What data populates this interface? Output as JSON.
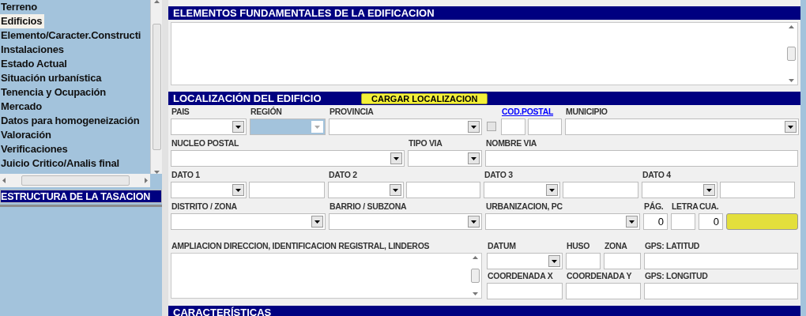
{
  "sidebar": {
    "items": [
      {
        "label": "Terreno",
        "selected": false
      },
      {
        "label": "Edificios",
        "selected": true
      },
      {
        "label": "Elemento/Caracter.Constructi",
        "selected": false
      },
      {
        "label": "Instalaciones",
        "selected": false
      },
      {
        "label": "Estado Actual",
        "selected": false
      },
      {
        "label": "Situación urbanística",
        "selected": false
      },
      {
        "label": "Tenencia y Ocupación",
        "selected": false
      },
      {
        "label": "Mercado",
        "selected": false
      },
      {
        "label": "Datos para homogeneización",
        "selected": false
      },
      {
        "label": "Valoración",
        "selected": false
      },
      {
        "label": "Verificaciones",
        "selected": false
      },
      {
        "label": "Juicio Critico/Analis final",
        "selected": false
      }
    ],
    "title": "ESTRUCTURA DE LA TASACION"
  },
  "memo_section": {
    "title": "ELEMENTOS FUNDAMENTALES DE LA EDIFICACION"
  },
  "location": {
    "title": "LOCALIZACIÓN DEL EDIFICIO",
    "action": "CARGAR LOCALIZACION",
    "rows": [
      {
        "fields": [
          {
            "label": "PAIS",
            "controls": [
              {
                "kind": "combo",
                "disabled": false
              }
            ]
          },
          {
            "label": "REGIÓN",
            "controls": [
              {
                "kind": "combo",
                "disabled": true
              }
            ]
          },
          {
            "label": "PROVINCIA",
            "controls": [
              {
                "kind": "combo",
                "disabled": false
              }
            ]
          },
          {
            "controls": [
              {
                "kind": "checkbox",
                "checked": false
              }
            ]
          },
          {
            "label": "COD.POSTAL",
            "link": true,
            "controls": [
              {
                "kind": "text"
              },
              {
                "kind": "text"
              }
            ]
          },
          {
            "label": "MUNICIPIO",
            "controls": [
              {
                "kind": "combo",
                "disabled": false
              }
            ]
          }
        ]
      },
      {
        "fields": [
          {
            "label": "NUCLEO POSTAL",
            "controls": [
              {
                "kind": "combo",
                "disabled": false
              }
            ]
          },
          {
            "label": "TIPO VIA",
            "controls": [
              {
                "kind": "combo",
                "disabled": false
              }
            ]
          },
          {
            "label": "NOMBRE VIA",
            "controls": [
              {
                "kind": "text"
              }
            ]
          }
        ]
      },
      {
        "fields": [
          {
            "label": "DATO 1",
            "controls": [
              {
                "kind": "combo",
                "disabled": false
              },
              {
                "kind": "text"
              }
            ]
          },
          {
            "label": "DATO 2",
            "controls": [
              {
                "kind": "combo",
                "disabled": false
              },
              {
                "kind": "text"
              }
            ]
          },
          {
            "label": "DATO 3",
            "controls": [
              {
                "kind": "combo",
                "disabled": false
              },
              {
                "kind": "text"
              }
            ]
          },
          {
            "label": "DATO 4",
            "controls": [
              {
                "kind": "combo",
                "disabled": false
              },
              {
                "kind": "text"
              }
            ]
          }
        ]
      },
      {
        "fields": [
          {
            "label": "DISTRITO / ZONA",
            "controls": [
              {
                "kind": "combo",
                "disabled": false
              }
            ]
          },
          {
            "label": "BARRIO / SUBZONA",
            "controls": [
              {
                "kind": "combo",
                "disabled": false
              }
            ]
          },
          {
            "label": "URBANIZACION, PC",
            "controls": [
              {
                "kind": "combo",
                "disabled": false
              }
            ]
          },
          {
            "label": "PÁG.",
            "controls": [
              {
                "kind": "text",
                "value": "0"
              }
            ]
          },
          {
            "label": "LETRA",
            "controls": [
              {
                "kind": "text"
              }
            ]
          },
          {
            "label": "CUA.",
            "controls": [
              {
                "kind": "text",
                "value": "0"
              }
            ]
          },
          {
            "controls": [
              {
                "kind": "button"
              }
            ]
          }
        ]
      }
    ],
    "notes": {
      "label": "AMPLIACION DIRECCION, IDENTIFICACION REGISTRAL, LINDEROS"
    },
    "coordinates": [
      {
        "fields": [
          {
            "label": "DATUM",
            "controls": [
              {
                "kind": "combo",
                "disabled": false
              }
            ]
          },
          {
            "label": "HUSO",
            "controls": [
              {
                "kind": "text"
              }
            ]
          },
          {
            "label": "ZONA",
            "controls": [
              {
                "kind": "text"
              }
            ]
          },
          {
            "label": "GPS: LATITUD",
            "controls": [
              {
                "kind": "text"
              }
            ]
          }
        ]
      },
      {
        "fields": [
          {
            "label": "COORDENADA X",
            "controls": [
              {
                "kind": "text"
              }
            ]
          },
          {
            "label": "COORDENADA Y",
            "controls": [
              {
                "kind": "text"
              }
            ]
          },
          {
            "label": "GPS: LONGITUD",
            "controls": [
              {
                "kind": "text"
              }
            ]
          }
        ]
      }
    ]
  },
  "next_section": {
    "title": "CARACTERÍSTICAS"
  }
}
